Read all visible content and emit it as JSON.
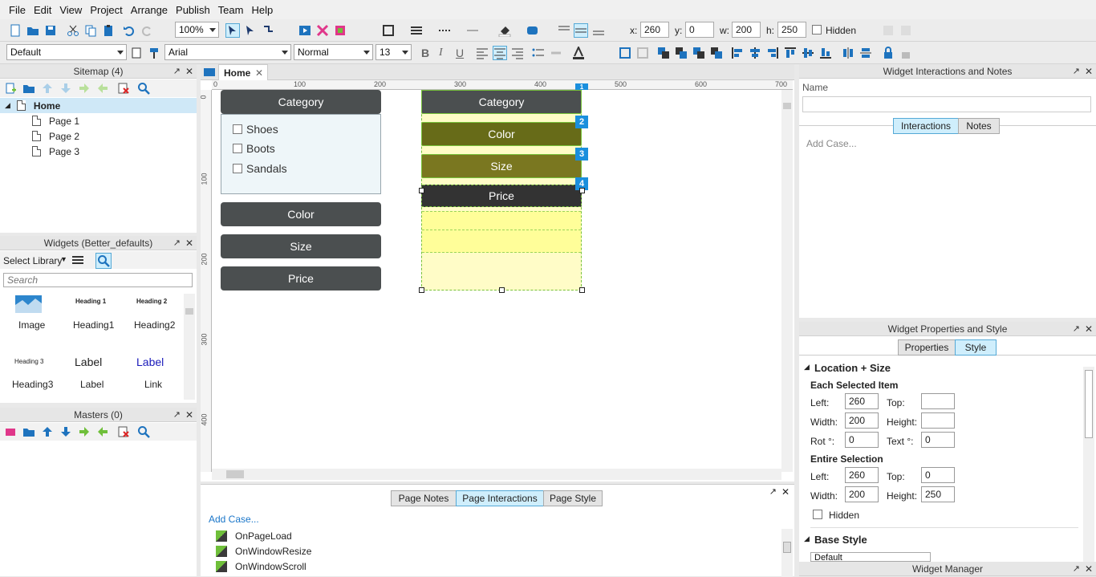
{
  "menu": [
    "File",
    "Edit",
    "View",
    "Project",
    "Arrange",
    "Publish",
    "Team",
    "Help"
  ],
  "toolbar": {
    "zoom": "100%",
    "x_label": "x:",
    "x_value": "260",
    "y_label": "y:",
    "y_value": "0",
    "w_label": "w:",
    "w_value": "200",
    "h_label": "h:",
    "h_value": "250",
    "hidden_label": "Hidden",
    "style_select": "Default",
    "font_select": "Arial",
    "weight_select": "Normal",
    "size_select": "13",
    "bold": "B",
    "italic": "I",
    "underline": "U"
  },
  "sitemap": {
    "title": "Sitemap (4)",
    "items": [
      {
        "label": "Home"
      },
      {
        "label": "Page 1"
      },
      {
        "label": "Page 2"
      },
      {
        "label": "Page 3"
      }
    ]
  },
  "widgets": {
    "title": "Widgets (Better_defaults)",
    "select_library": "Select Library",
    "search_placeholder": "Search",
    "items": [
      {
        "preview": "",
        "label": "Image"
      },
      {
        "preview": "Heading 1",
        "label": "Heading1"
      },
      {
        "preview": "Heading 2",
        "label": "Heading2"
      },
      {
        "preview": "Heading 3",
        "label": "Heading3"
      },
      {
        "preview": "Label",
        "label": "Label"
      },
      {
        "preview": "Label",
        "label": "Link"
      }
    ]
  },
  "masters": {
    "title": "Masters (0)"
  },
  "canvas": {
    "tab_label": "Home",
    "ruler_top": [
      "0",
      "100",
      "200",
      "300",
      "400",
      "500",
      "600",
      "700"
    ],
    "ruler_left": [
      "0",
      "100",
      "200",
      "300",
      "400"
    ],
    "left_group": {
      "category": "Category",
      "checkboxes": [
        "Shoes",
        "Boots",
        "Sandals"
      ],
      "color": "Color",
      "size": "Size",
      "price": "Price"
    },
    "right_group": {
      "items": [
        {
          "label": "Category",
          "badge": "1",
          "color": "#333333"
        },
        {
          "label": "Color",
          "badge": "2",
          "color": "#676b18"
        },
        {
          "label": "Size",
          "badge": "3",
          "color": "#7a7720"
        },
        {
          "label": "Price",
          "badge": "4",
          "color": "#333333"
        }
      ]
    }
  },
  "page_panel": {
    "tabs": [
      "Page Notes",
      "Page Interactions",
      "Page Style"
    ],
    "add_case": "Add Case...",
    "events": [
      "OnPageLoad",
      "OnWindowResize",
      "OnWindowScroll"
    ]
  },
  "interactions_panel": {
    "title": "Widget Interactions and Notes",
    "name_label": "Name",
    "tabs": [
      "Interactions",
      "Notes"
    ],
    "add_case": "Add Case..."
  },
  "properties_panel": {
    "title": "Widget Properties and Style",
    "tabs": [
      "Properties",
      "Style"
    ],
    "section": "Location + Size",
    "each_selected": "Each Selected Item",
    "left_label": "Left:",
    "left_value": "260",
    "top_label": "Top:",
    "top_value": "",
    "width_label": "Width:",
    "width_value": "200",
    "height_label": "Height:",
    "height_value": "",
    "rot_label": "Rot °:",
    "rot_value": "0",
    "text_label": "Text °:",
    "text_value": "0",
    "entire_selection": "Entire Selection",
    "e_left_value": "260",
    "e_top_value": "0",
    "e_width_value": "200",
    "e_height_value": "250",
    "hidden_label": "Hidden",
    "base_style": "Base Style",
    "base_style_value": "Default"
  },
  "widget_manager": {
    "title": "Widget Manager"
  },
  "colors": {
    "accent": "#1a8fdd",
    "active_tab": "#cfeefc",
    "button": "#4b4f50"
  }
}
